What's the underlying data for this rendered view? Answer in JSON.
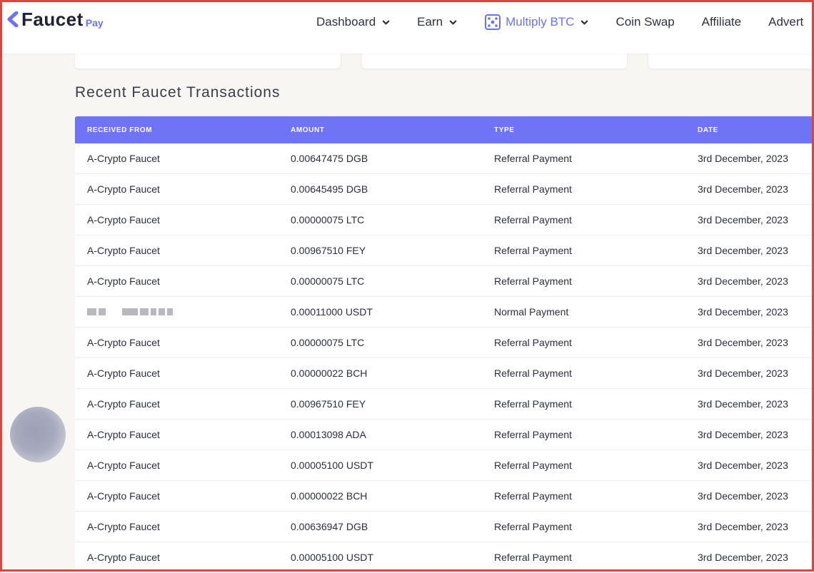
{
  "brand": {
    "name": "Faucet",
    "suffix": "Pay",
    "accent": "#6e74f5",
    "border": "#d9463e"
  },
  "nav": {
    "items": [
      {
        "label": "Dashboard",
        "has_dropdown": true,
        "icon": "chevron-down-icon"
      },
      {
        "label": "Earn",
        "has_dropdown": true,
        "icon": "chevron-down-icon"
      },
      {
        "label": "Multiply BTC",
        "has_dropdown": true,
        "active": true,
        "icon": "dice-icon"
      },
      {
        "label": "Coin Swap",
        "has_dropdown": false
      },
      {
        "label": "Affiliate",
        "has_dropdown": false
      },
      {
        "label": "Advert",
        "has_dropdown": false
      }
    ]
  },
  "section": {
    "title": "Recent Faucet Transactions"
  },
  "table": {
    "columns": [
      "RECEIVED FROM",
      "AMOUNT",
      "TYPE",
      "DATE"
    ],
    "rows": [
      {
        "from": "A-Crypto Faucet",
        "amount": "0.00647475 DGB",
        "type": "Referral Payment",
        "date": "3rd December, 2023"
      },
      {
        "from": "A-Crypto Faucet",
        "amount": "0.00645495 DGB",
        "type": "Referral Payment",
        "date": "3rd December, 2023"
      },
      {
        "from": "A-Crypto Faucet",
        "amount": "0.00000075 LTC",
        "type": "Referral Payment",
        "date": "3rd December, 2023"
      },
      {
        "from": "A-Crypto Faucet",
        "amount": "0.00967510 FEY",
        "type": "Referral Payment",
        "date": "3rd December, 2023"
      },
      {
        "from": "A-Crypto Faucet",
        "amount": "0.00000075 LTC",
        "type": "Referral Payment",
        "date": "3rd December, 2023"
      },
      {
        "from": "",
        "redacted": true,
        "amount": "0.00011000 USDT",
        "type": "Normal Payment",
        "date": "3rd December, 2023"
      },
      {
        "from": "A-Crypto Faucet",
        "amount": "0.00000075 LTC",
        "type": "Referral Payment",
        "date": "3rd December, 2023"
      },
      {
        "from": "A-Crypto Faucet",
        "amount": "0.00000022 BCH",
        "type": "Referral Payment",
        "date": "3rd December, 2023"
      },
      {
        "from": "A-Crypto Faucet",
        "amount": "0.00967510 FEY",
        "type": "Referral Payment",
        "date": "3rd December, 2023"
      },
      {
        "from": "A-Crypto Faucet",
        "amount": "0.00013098 ADA",
        "type": "Referral Payment",
        "date": "3rd December, 2023"
      },
      {
        "from": "A-Crypto Faucet",
        "amount": "0.00005100 USDT",
        "type": "Referral Payment",
        "date": "3rd December, 2023"
      },
      {
        "from": "A-Crypto Faucet",
        "amount": "0.00000022 BCH",
        "type": "Referral Payment",
        "date": "3rd December, 2023"
      },
      {
        "from": "A-Crypto Faucet",
        "amount": "0.00636947 DGB",
        "type": "Referral Payment",
        "date": "3rd December, 2023"
      },
      {
        "from": "A-Crypto Faucet",
        "amount": "0.00005100 USDT",
        "type": "Referral Payment",
        "date": "3rd December, 2023"
      }
    ]
  }
}
